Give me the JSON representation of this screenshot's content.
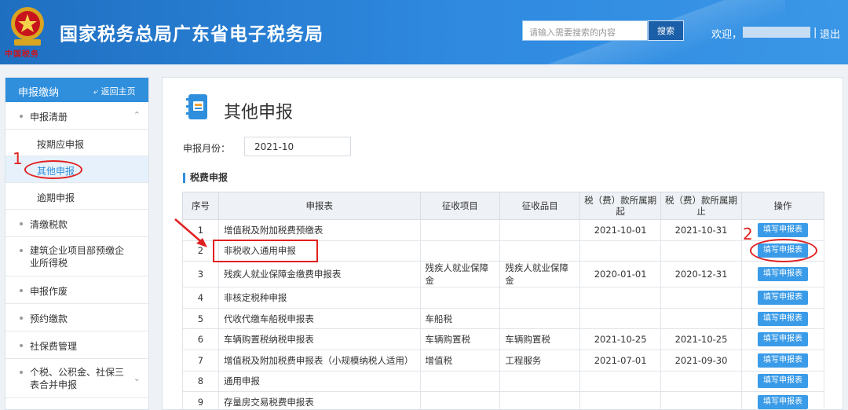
{
  "header": {
    "title": "国家税务总局广东省电子税务局",
    "emblem_script": "中国税务",
    "search_placeholder": "请输入需要搜索的内容",
    "search_button": "搜索",
    "welcome": "欢迎，",
    "separator": "|",
    "logout": "退出"
  },
  "sidebar": {
    "title": "申报缴纳",
    "back": "返回主页",
    "back_icon": "arrow-back-icon",
    "groups": [
      {
        "label": "申报清册",
        "expanded": true
      },
      {
        "label": "按期应申报"
      },
      {
        "label": "其他申报",
        "active": true
      },
      {
        "label": "逾期申报"
      },
      {
        "label": "清缴税款"
      },
      {
        "label": "建筑企业项目部预缴企业所得税"
      },
      {
        "label": "申报作废"
      },
      {
        "label": "预约缴款"
      },
      {
        "label": "社保费管理"
      },
      {
        "label": "个税、公积金、社保三表合并申报"
      }
    ]
  },
  "main": {
    "page_title": "其他申报",
    "month_label": "申报月份：",
    "month_value": "2021-10",
    "section_title": "税费申报",
    "columns": [
      "序号",
      "申报表",
      "征收项目",
      "征收品目",
      "税（费）款所属期起",
      "税（费）款所属期止",
      "操作"
    ],
    "rows": [
      {
        "no": "1",
        "form": "增值税及附加税费预缴表",
        "item": "",
        "sub": "",
        "start": "2021-10-01",
        "end": "2021-10-31",
        "action": "填写申报表"
      },
      {
        "no": "2",
        "form": "非税收入通用申报",
        "item": "",
        "sub": "",
        "start": "",
        "end": "",
        "action": "填写申报表"
      },
      {
        "no": "3",
        "form": "残疾人就业保障金缴费申报表",
        "item": "残疾人就业保障金",
        "sub": "残疾人就业保障金",
        "start": "2020-01-01",
        "end": "2020-12-31",
        "action": "填写申报表"
      },
      {
        "no": "4",
        "form": "非核定税种申报",
        "item": "",
        "sub": "",
        "start": "",
        "end": "",
        "action": "填写申报表"
      },
      {
        "no": "5",
        "form": "代收代缴车船税申报表",
        "item": "车船税",
        "sub": "",
        "start": "",
        "end": "",
        "action": "填写申报表"
      },
      {
        "no": "6",
        "form": "车辆购置税纳税申报表",
        "item": "车辆购置税",
        "sub": "车辆购置税",
        "start": "2021-10-25",
        "end": "2021-10-25",
        "action": "填写申报表"
      },
      {
        "no": "7",
        "form": "增值税及附加税费申报表（小规模纳税人适用）",
        "item": "增值税",
        "sub": "工程服务",
        "start": "2021-07-01",
        "end": "2021-09-30",
        "action": "填写申报表"
      },
      {
        "no": "8",
        "form": "通用申报",
        "item": "",
        "sub": "",
        "start": "",
        "end": "",
        "action": "填写申报表"
      },
      {
        "no": "9",
        "form": "存量房交易税费申报表",
        "item": "",
        "sub": "",
        "start": "",
        "end": "",
        "action": "填写申报表"
      }
    ]
  },
  "annotations": {
    "label1": "1",
    "label2": "2",
    "color": "#e02020"
  },
  "colors": {
    "header": "#2f8ae0",
    "accent": "#2f8fdc",
    "button": "#3a9be8"
  }
}
